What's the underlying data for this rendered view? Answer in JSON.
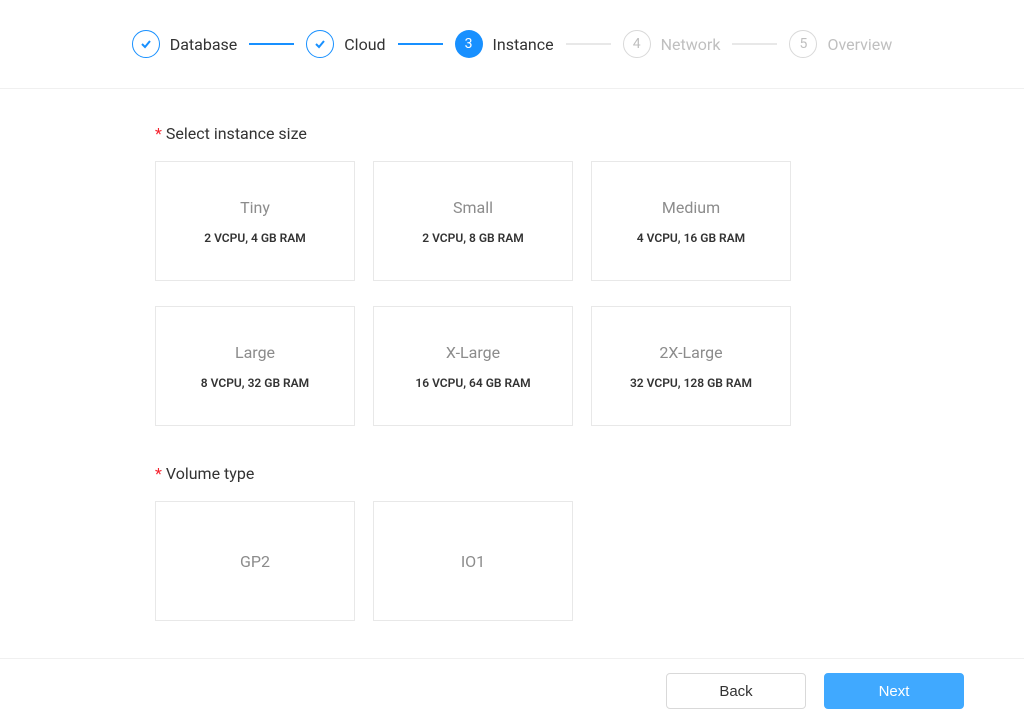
{
  "stepper": {
    "steps": [
      {
        "label": "Database",
        "status": "completed",
        "number": "1"
      },
      {
        "label": "Cloud",
        "status": "completed",
        "number": "2"
      },
      {
        "label": "Instance",
        "status": "active",
        "number": "3"
      },
      {
        "label": "Network",
        "status": "pending",
        "number": "4"
      },
      {
        "label": "Overview",
        "status": "pending",
        "number": "5"
      }
    ]
  },
  "sections": {
    "instance_size": {
      "label": "Select instance size",
      "options": [
        {
          "title": "Tiny",
          "spec": "2 VCPU, 4 GB RAM"
        },
        {
          "title": "Small",
          "spec": "2 VCPU, 8 GB RAM"
        },
        {
          "title": "Medium",
          "spec": "4 VCPU, 16 GB RAM"
        },
        {
          "title": "Large",
          "spec": "8 VCPU, 32 GB RAM"
        },
        {
          "title": "X-Large",
          "spec": "16 VCPU, 64 GB RAM"
        },
        {
          "title": "2X-Large",
          "spec": "32 VCPU, 128 GB RAM"
        }
      ]
    },
    "volume_type": {
      "label": "Volume type",
      "options": [
        {
          "title": "GP2"
        },
        {
          "title": "IO1"
        }
      ]
    }
  },
  "footer": {
    "back_label": "Back",
    "next_label": "Next"
  },
  "required_mark": "*"
}
